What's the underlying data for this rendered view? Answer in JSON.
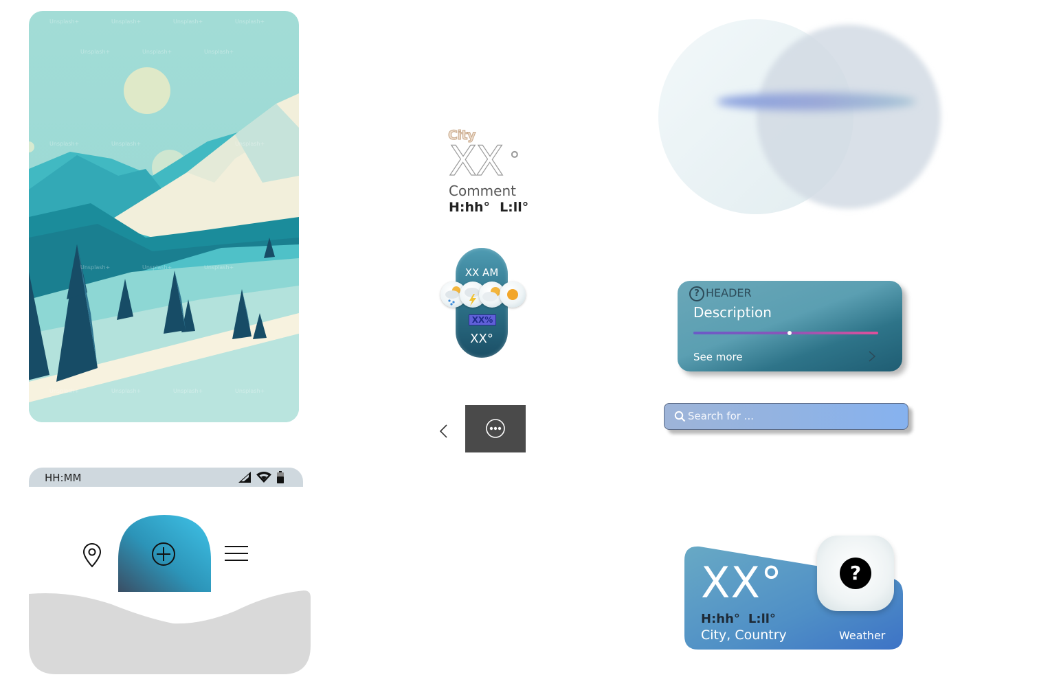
{
  "landscape": {
    "alt": "Mountain landscape illustration",
    "watermark": "Unsplash+"
  },
  "status_bar": {
    "time": "HH:MM",
    "icons": [
      "signal-icon",
      "wifi-icon",
      "battery-icon"
    ]
  },
  "nav": {
    "items": [
      "location-pin-icon",
      "add-circle-icon",
      "menu-icon"
    ]
  },
  "current_weather": {
    "city": "City",
    "temp": "XX",
    "degree": "°",
    "comment": "Comment",
    "high": "H:hh°",
    "low": "L:ll°"
  },
  "hourly": {
    "time": "XX AM",
    "precip": "XX%",
    "temp": "XX°",
    "icons": [
      "rain-cloud-icon",
      "thunder-icon",
      "cloud-sun-icon",
      "sun-icon"
    ]
  },
  "header_card": {
    "header": "HEADER",
    "description": "Description",
    "progress": 0.52,
    "see_more": "See more"
  },
  "search": {
    "placeholder": "Search for ..."
  },
  "widget": {
    "temp": "XX°",
    "high": "H:hh°",
    "low": "L:ll°",
    "location": "City, Country",
    "label": "Weather",
    "help_icon": "?"
  },
  "colors": {
    "accent_teal": "#2e7489",
    "search_blue": "#86b2ef",
    "progress_start": "#6a5bc7",
    "progress_end": "#e0509a"
  }
}
